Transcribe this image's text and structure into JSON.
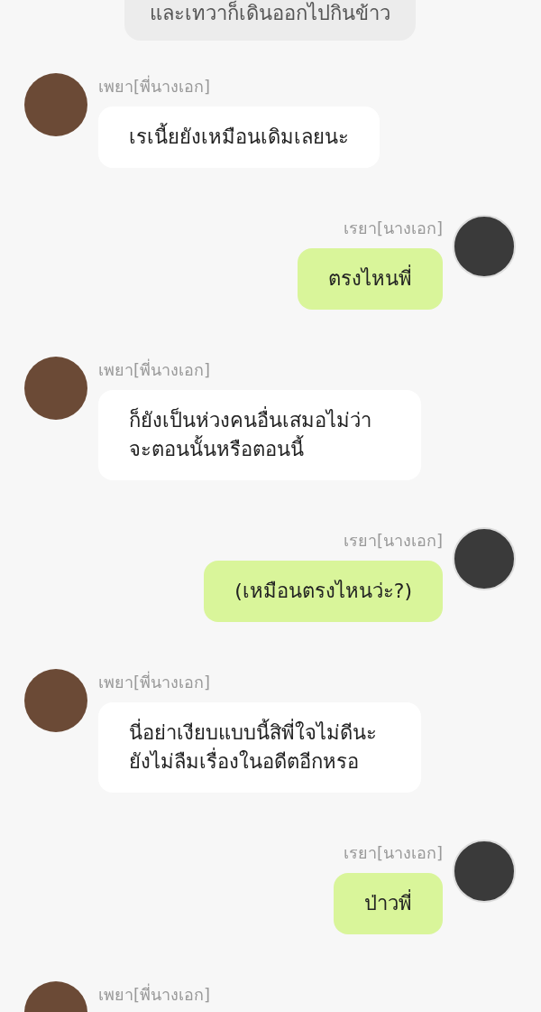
{
  "narration": "และเทวาก็เดินออกไปกินข้าว",
  "messages": [
    {
      "kind": "incoming",
      "sender": "เพยา[พี่นางเอก]",
      "text": "เรเนี้ยยังเหมือนเดิมเลยนะ"
    },
    {
      "kind": "outgoing",
      "sender": "เรยา[นางเอก]",
      "text": "ตรงไหนพี่"
    },
    {
      "kind": "incoming",
      "sender": "เพยา[พี่นางเอก]",
      "text": "ก็ยังเป็นห่วงคนอื่นเสมอไม่ว่าจะตอนนั้นหรือตอนนี้"
    },
    {
      "kind": "outgoing",
      "sender": "เรยา[นางเอก]",
      "text": "(เหมือนตรงไหนว่ะ?)"
    },
    {
      "kind": "incoming",
      "sender": "เพยา[พี่นางเอก]",
      "text": "นี่อย่าเงียบแบบนี้สิพี่ใจไม่ดีนะ ยังไม่ลืมเรื่องในอดีตอีกหรอ"
    },
    {
      "kind": "outgoing",
      "sender": "เรยา[นางเอก]",
      "text": "ป่าวพี่"
    },
    {
      "kind": "incoming",
      "sender": "เพยา[พี่นางเอก]"
    }
  ]
}
